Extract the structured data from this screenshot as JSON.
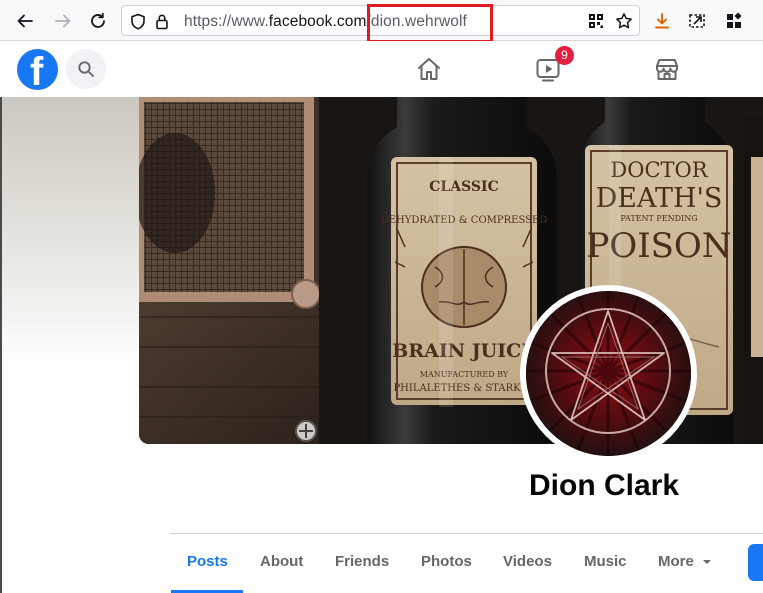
{
  "browser": {
    "url_prefix": "https://www.",
    "url_domain": "facebook.com",
    "url_path": "/dion.wehrwolf"
  },
  "header": {
    "logo_letter": "f",
    "watch_badge_count": "9"
  },
  "profile": {
    "name": "Dion Clark"
  },
  "cover_labels": {
    "bottle1_top": "CLASSIC",
    "bottle1_mid": "DEHYDRATED & COMPRESSED",
    "bottle1_main": "BRAIN JUICE",
    "bottle1_sub": "MANUFACTURED BY",
    "bottle1_maker": "PHILALETHES & STARKEY",
    "bottle2_top": "DOCTOR",
    "bottle2_mid": "DEATH'S",
    "bottle2_patent": "PATENT PENDING",
    "bottle2_main": "POISON"
  },
  "tabs": {
    "posts": "Posts",
    "about": "About",
    "friends": "Friends",
    "photos": "Photos",
    "videos": "Videos",
    "music": "Music",
    "more": "More"
  },
  "colors": {
    "facebook_blue": "#1877f2",
    "highlight_red": "#e01b24",
    "badge_red": "#e41e3f"
  }
}
